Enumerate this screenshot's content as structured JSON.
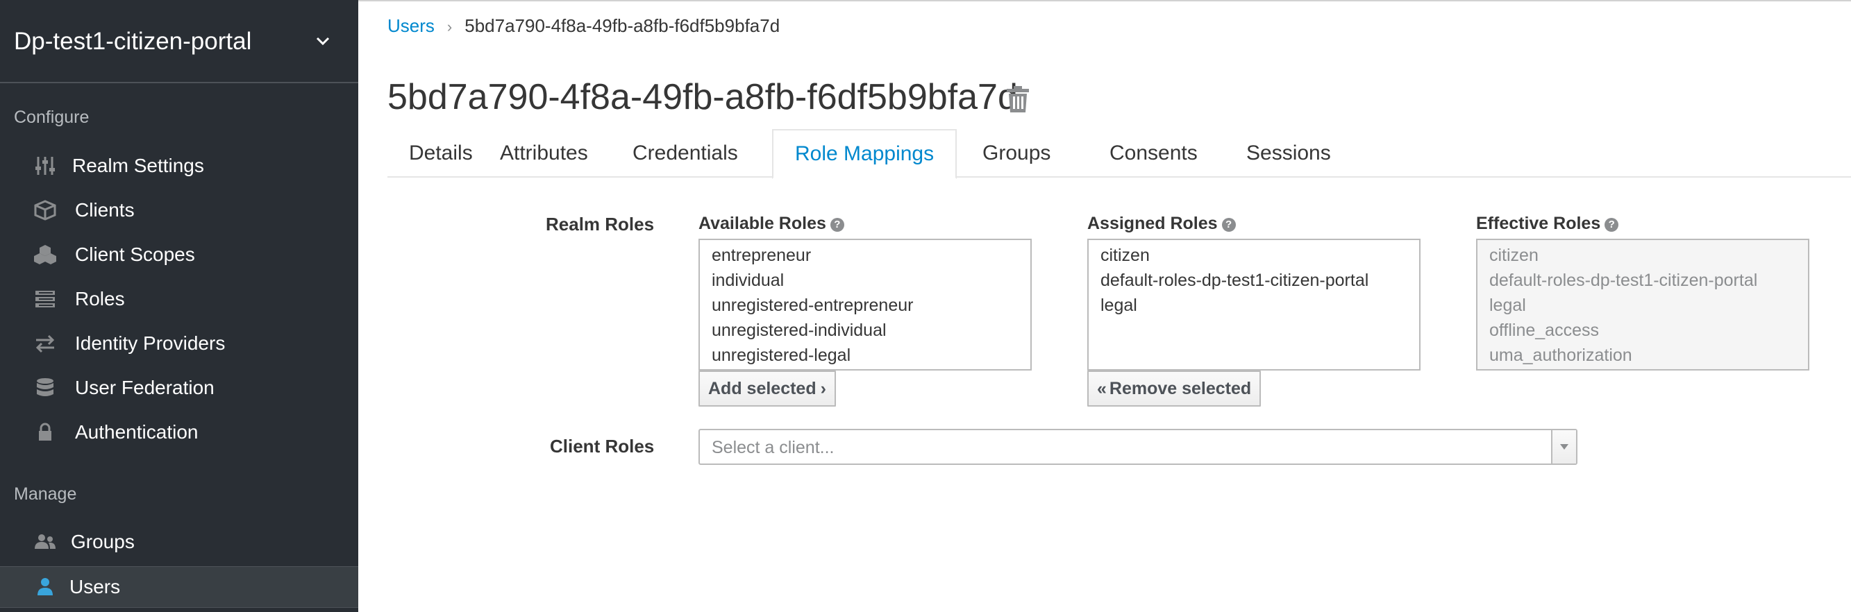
{
  "sidebar": {
    "realm_name": "Dp-test1-citizen-portal",
    "configure_label": "Configure",
    "manage_label": "Manage",
    "configure_items": [
      {
        "label": "Realm Settings",
        "icon": "sliders-icon"
      },
      {
        "label": "Clients",
        "icon": "cube-icon"
      },
      {
        "label": "Client Scopes",
        "icon": "cubes-icon"
      },
      {
        "label": "Roles",
        "icon": "list-icon"
      },
      {
        "label": "Identity Providers",
        "icon": "exchange-icon"
      },
      {
        "label": "User Federation",
        "icon": "database-icon"
      },
      {
        "label": "Authentication",
        "icon": "lock-icon"
      }
    ],
    "manage_items": [
      {
        "label": "Groups",
        "icon": "users-icon"
      },
      {
        "label": "Users",
        "icon": "user-icon",
        "active": true
      }
    ]
  },
  "breadcrumb": {
    "parent": "Users",
    "current": "5bd7a790-4f8a-49fb-a8fb-f6df5b9bfa7d"
  },
  "page_title": "5bd7a790-4f8a-49fb-a8fb-f6df5b9bfa7d",
  "tabs": [
    {
      "label": "Details"
    },
    {
      "label": "Attributes"
    },
    {
      "label": "Credentials"
    },
    {
      "label": "Role Mappings",
      "active": true
    },
    {
      "label": "Groups"
    },
    {
      "label": "Consents"
    },
    {
      "label": "Sessions"
    }
  ],
  "role_mappings": {
    "realm_roles_label": "Realm Roles",
    "client_roles_label": "Client Roles",
    "available": {
      "title": "Available Roles",
      "items": [
        "entrepreneur",
        "individual",
        "unregistered-entrepreneur",
        "unregistered-individual",
        "unregistered-legal"
      ],
      "button": "Add selected"
    },
    "assigned": {
      "title": "Assigned Roles",
      "items": [
        "citizen",
        "default-roles-dp-test1-citizen-portal",
        "legal"
      ],
      "button": "Remove selected"
    },
    "effective": {
      "title": "Effective Roles",
      "items": [
        "citizen",
        "default-roles-dp-test1-citizen-portal",
        "legal",
        "offline_access",
        "uma_authorization"
      ]
    },
    "client_select_placeholder": "Select a client..."
  },
  "colors": {
    "sidebar_bg": "#292e34",
    "active_item_bg": "#393f44",
    "accent": "#0088ce",
    "user_icon": "#39a5dc"
  }
}
